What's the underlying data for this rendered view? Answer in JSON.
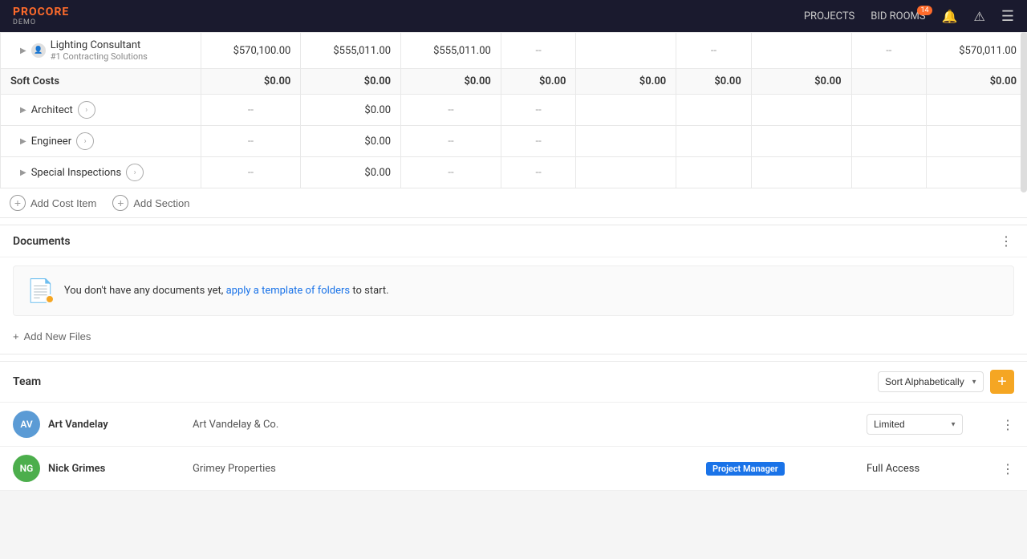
{
  "nav": {
    "logo": "PROCORE",
    "demo": "DEMO",
    "projects": "PROJECTS",
    "bid_rooms": "BID ROOMS",
    "notifications_count": "14"
  },
  "table": {
    "lighting_consultant": {
      "name": "Lighting Consultant",
      "sub": "#1 Contracting Solutions",
      "col1": "$570,100.00",
      "col2": "$555,011.00",
      "col3": "$555,011.00",
      "col4": "--",
      "col5": "--",
      "col6": "--",
      "col7": "--",
      "col8": "$570,011.00"
    },
    "soft_costs": {
      "label": "Soft Costs",
      "col1": "$0.00",
      "col2": "$0.00",
      "col3": "$0.00",
      "col4": "$0.00",
      "col5": "$0.00",
      "col6": "$0.00",
      "col7": "$0.00",
      "col8": "$0.00"
    },
    "architect": {
      "name": "Architect",
      "col1": "--",
      "col2": "$0.00",
      "col3": "--",
      "col4": "--"
    },
    "engineer": {
      "name": "Engineer",
      "col1": "--",
      "col2": "$0.00",
      "col3": "--",
      "col4": "--"
    },
    "special_inspections": {
      "name": "Special Inspections",
      "col1": "--",
      "col2": "$0.00",
      "col3": "--",
      "col4": "--"
    }
  },
  "add_buttons": {
    "add_cost_item": "Add Cost Item",
    "add_section": "Add Section"
  },
  "documents": {
    "title": "Documents",
    "empty_text": "You don't have any documents yet,",
    "link_text": "apply a template of folders",
    "link_after": " to start.",
    "add_files": "Add New Files"
  },
  "team": {
    "title": "Team",
    "sort_label": "Sort Alphabetically",
    "members": [
      {
        "initials": "AV",
        "name": "Art Vandelay",
        "company": "Art Vandelay & Co.",
        "role": "",
        "access": "Limited",
        "avatar_color": "#5b9bd5"
      },
      {
        "initials": "NG",
        "name": "Nick Grimes",
        "company": "Grimey Properties",
        "role": "Project Manager",
        "access": "Full Access",
        "avatar_color": "#4cae4c"
      }
    ]
  }
}
